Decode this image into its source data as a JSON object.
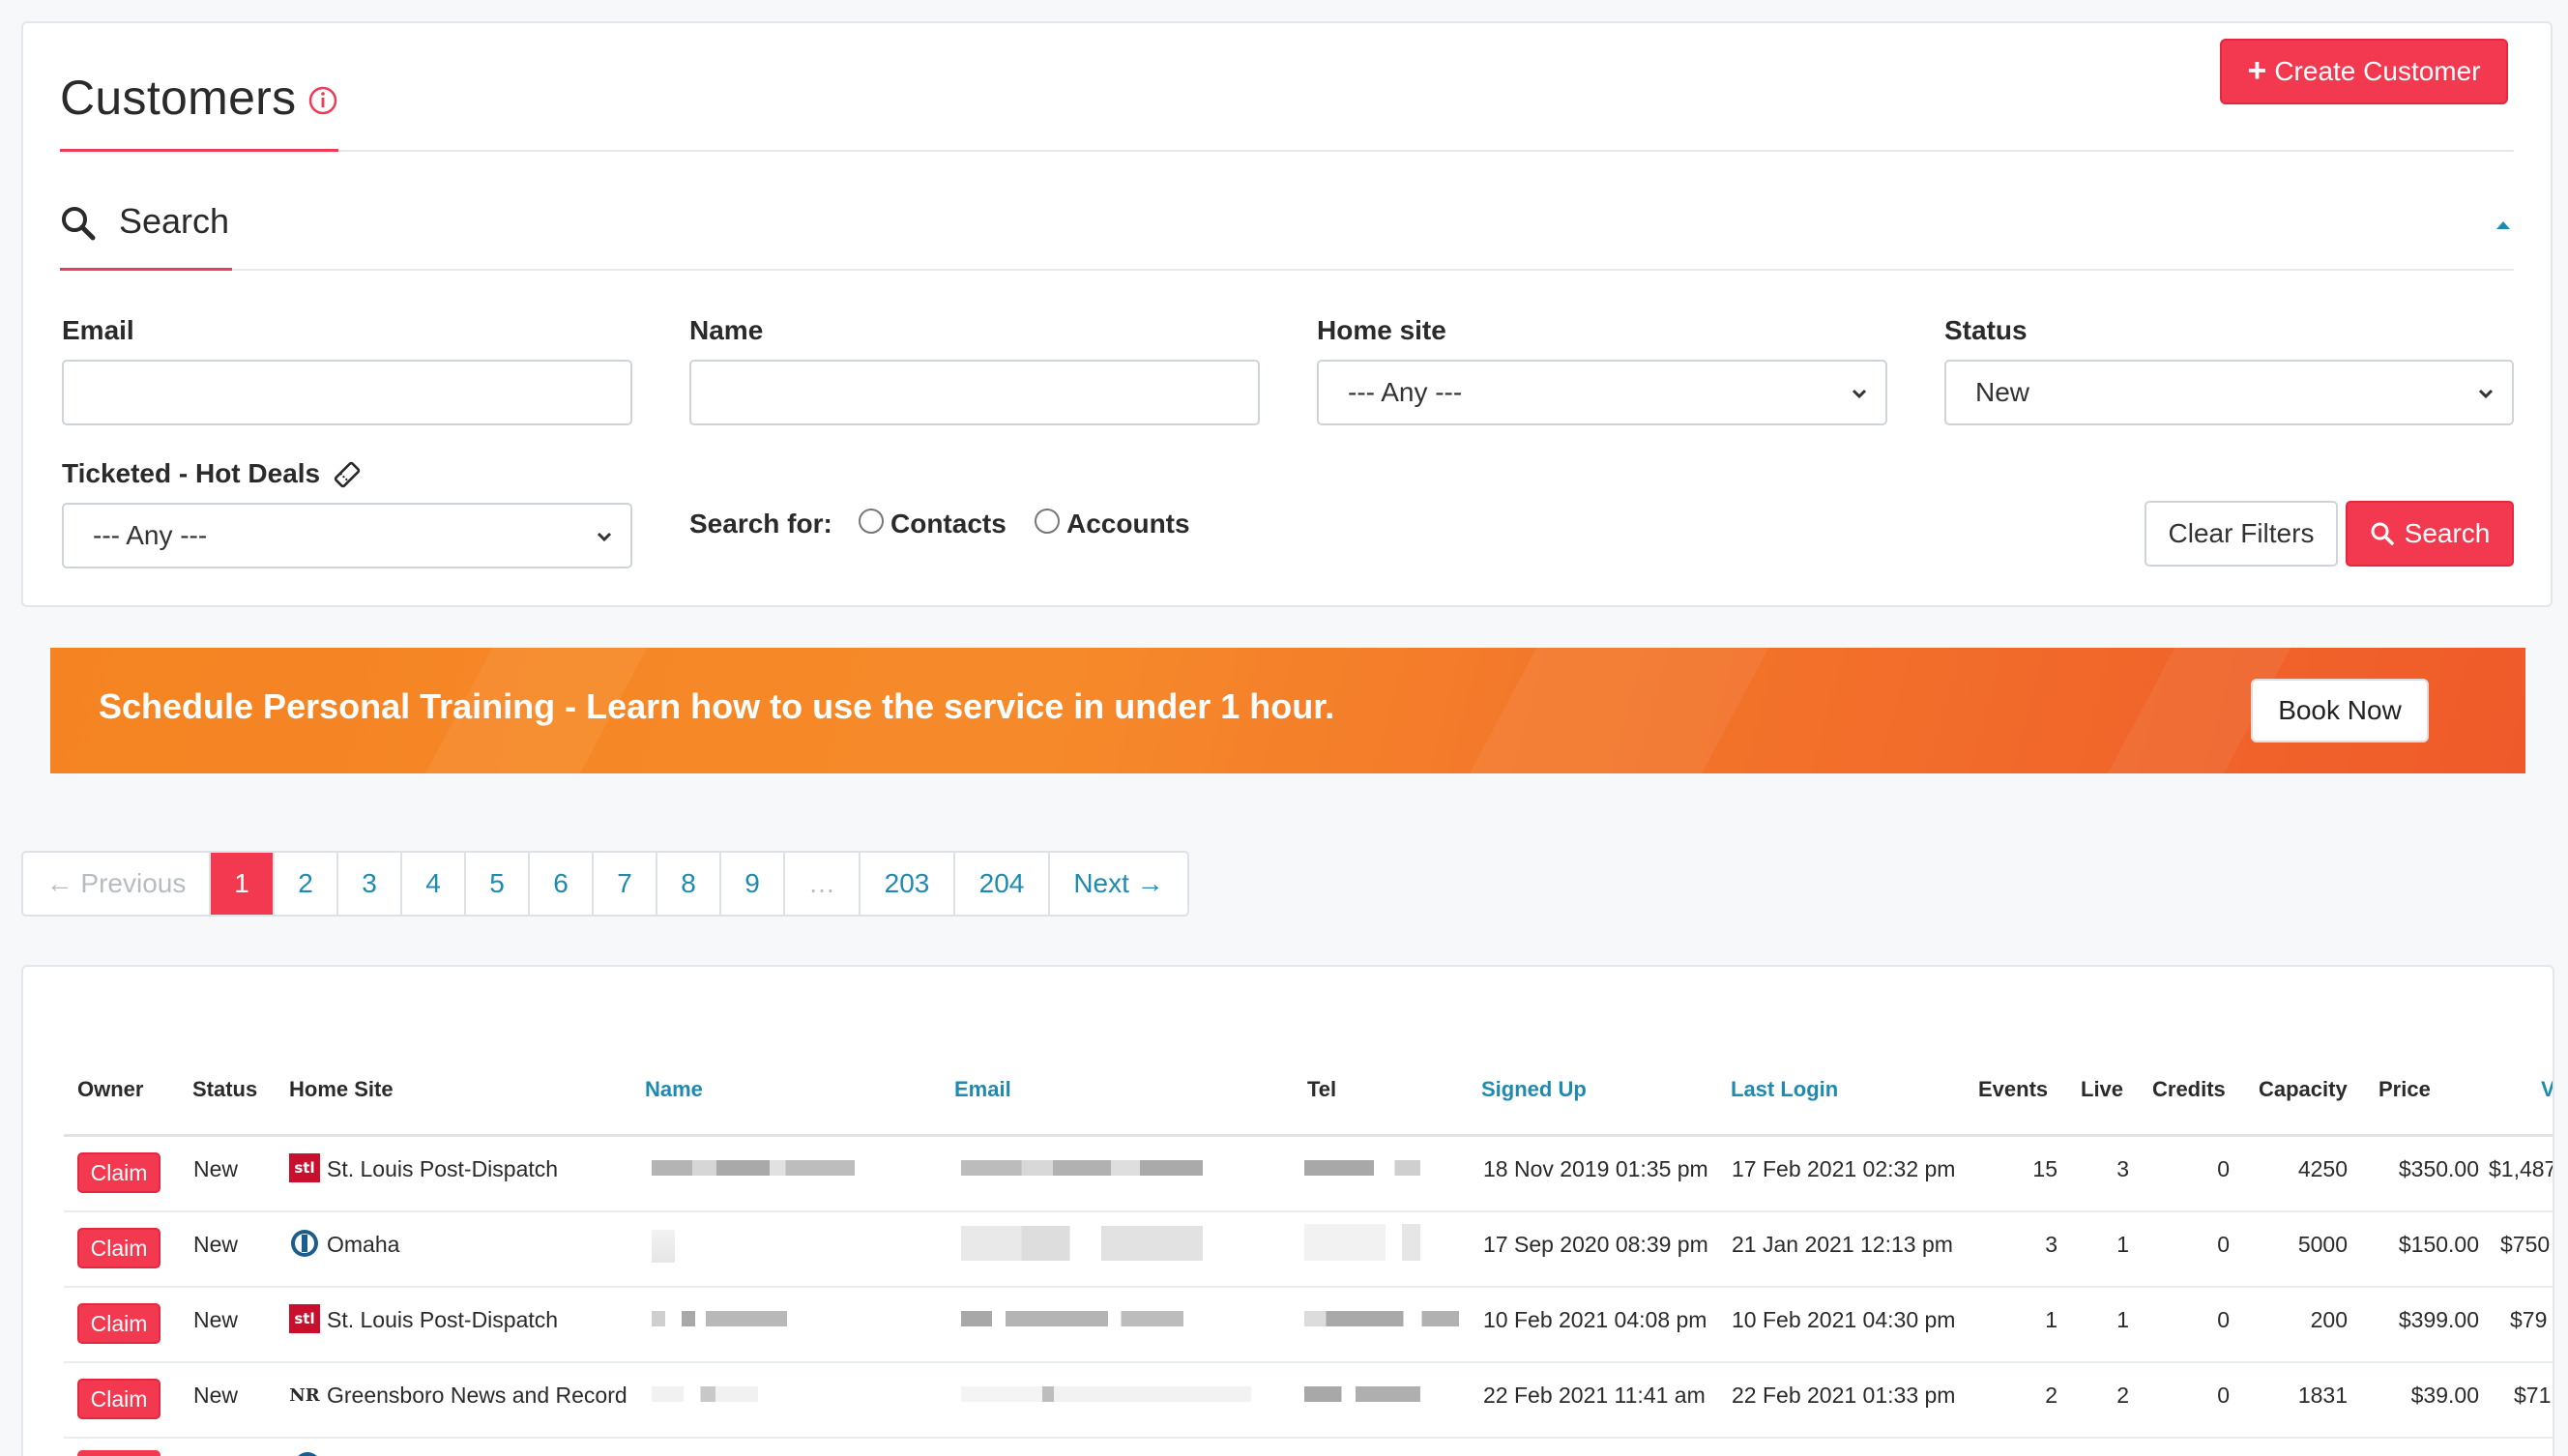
{
  "header": {
    "title": "Customers",
    "create_label": "Create Customer"
  },
  "search": {
    "title": "Search",
    "email_label": "Email",
    "email_value": "",
    "name_label": "Name",
    "name_value": "",
    "home_site_label": "Home site",
    "home_site_value": "--- Any ---",
    "status_label": "Status",
    "status_value": "New",
    "ticketed_label": "Ticketed - Hot Deals",
    "ticketed_value": "--- Any ---",
    "search_for_label": "Search for:",
    "contacts_label": "Contacts",
    "accounts_label": "Accounts",
    "clear_label": "Clear Filters",
    "search_label": "Search"
  },
  "banner": {
    "text": "Schedule Personal Training - Learn how to use the service in under 1 hour.",
    "button_label": "Book Now"
  },
  "pagination": {
    "previous": "← Previous",
    "pages": [
      "1",
      "2",
      "3",
      "4",
      "5",
      "6",
      "7",
      "8",
      "9"
    ],
    "ellipsis": "…",
    "last_pages": [
      "203",
      "204"
    ],
    "next": "Next →",
    "active": "1"
  },
  "table": {
    "columns": [
      "Owner",
      "Status",
      "Home Site",
      "Name",
      "Email",
      "Tel",
      "Signed Up",
      "Last Login",
      "Events",
      "Live",
      "Credits",
      "Capacity",
      "Price",
      "V"
    ],
    "claim_label": "Claim",
    "rows": [
      {
        "status": "New",
        "home_site": "St. Louis Post-Dispatch",
        "signed_up": "18 Nov 2019 01:35 pm",
        "last_login": "17 Feb 2021 02:32 pm",
        "events": "15",
        "live": "3",
        "credits": "0",
        "capacity": "4250",
        "price": "$350.00",
        "value": "$1,487"
      },
      {
        "status": "New",
        "home_site": "Omaha",
        "signed_up": "17 Sep 2020 08:39 pm",
        "last_login": "21 Jan 2021 12:13 pm",
        "events": "3",
        "live": "1",
        "credits": "0",
        "capacity": "5000",
        "price": "$150.00",
        "value": "$750"
      },
      {
        "status": "New",
        "home_site": "St. Louis Post-Dispatch",
        "signed_up": "10 Feb 2021 04:08 pm",
        "last_login": "10 Feb 2021 04:30 pm",
        "events": "1",
        "live": "1",
        "credits": "0",
        "capacity": "200",
        "price": "$399.00",
        "value": "$79"
      },
      {
        "status": "New",
        "home_site": "Greensboro News and Record",
        "signed_up": "22 Feb 2021 11:41 am",
        "last_login": "22 Feb 2021 01:33 pm",
        "events": "2",
        "live": "2",
        "credits": "0",
        "capacity": "1831",
        "price": "$39.00",
        "value": "$71"
      }
    ]
  },
  "icons": {
    "info": "info-circle-icon",
    "search": "magnifier-icon",
    "ticket": "ticket-icon",
    "chevron": "chevron-down-icon",
    "collapse": "caret-up-icon"
  },
  "colors": {
    "accent": "#f3394f",
    "link": "#1f8ab0",
    "banner": "#f58322"
  }
}
